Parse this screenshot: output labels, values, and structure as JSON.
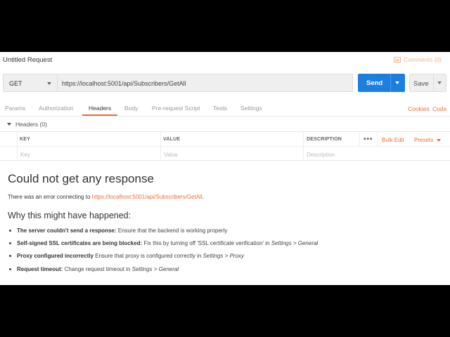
{
  "request": {
    "title": "Untitled Request",
    "comments_label": "Comments (0)",
    "method": "GET",
    "url": "https://localhost:5001/api/Subscribers/GetAll",
    "send_label": "Send",
    "save_label": "Save"
  },
  "tabs": [
    {
      "label": "Params"
    },
    {
      "label": "Authorization"
    },
    {
      "label": "Headers"
    },
    {
      "label": "Body"
    },
    {
      "label": "Pre-request Script"
    },
    {
      "label": "Tests"
    },
    {
      "label": "Settings"
    }
  ],
  "tab_links": {
    "cookies": "Cookies",
    "code": "Code"
  },
  "headers_section": {
    "toggle_label": "Headers",
    "count": "(0)",
    "columns": {
      "key": "KEY",
      "value": "VALUE",
      "description": "DESCRIPTION"
    },
    "more": "•••",
    "bulk_edit": "Bulk Edit",
    "presets": "Presets",
    "placeholders": {
      "key": "Key",
      "value": "Value",
      "description": "Description"
    }
  },
  "error": {
    "title": "Could not get any response",
    "message_prefix": "There was an error connecting to ",
    "message_link": "https://localhost:5001/api/Subscribers/GetAll",
    "message_suffix": ".",
    "why_heading": "Why this might have happened:",
    "reasons": [
      {
        "bold": "The server couldn't send a response:",
        "text": " Ensure that the backend is working properly",
        "em": "",
        "text2": ""
      },
      {
        "bold": "Self-signed SSL certificates are being blocked:",
        "text": " Fix this by turning off 'SSL certificate verification' in ",
        "em": "Settings > General",
        "text2": ""
      },
      {
        "bold": "Proxy configured incorrectly",
        "text": " Ensure that proxy is configured correctly in ",
        "em": "Settings > Proxy",
        "text2": ""
      },
      {
        "bold": "Request timeout:",
        "text": " Change request timeout in ",
        "em": "Settings > General",
        "text2": ""
      }
    ]
  }
}
